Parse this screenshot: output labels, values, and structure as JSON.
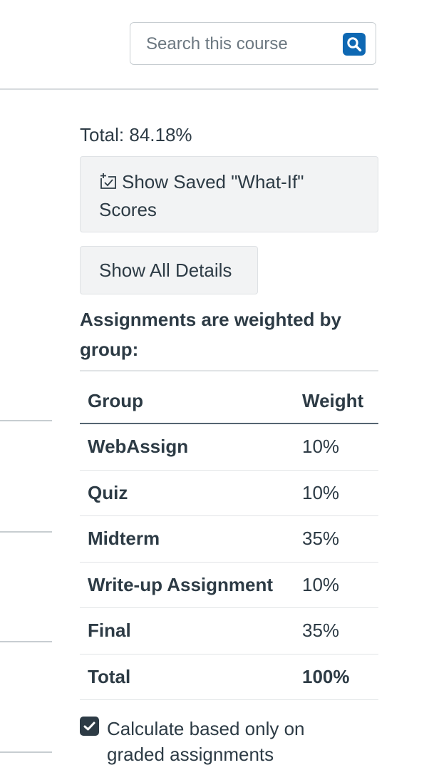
{
  "search": {
    "placeholder": "Search this course",
    "icon": "search-icon"
  },
  "grade": {
    "total_text": "Total: 84.18%"
  },
  "buttons": {
    "whatif_label": "Show Saved \"What-If\" Scores",
    "whatif_icon": "calendar-check-icon",
    "details_label": "Show All Details"
  },
  "weights": {
    "heading": "Assignments are weighted by group:",
    "columns": {
      "group": "Group",
      "weight": "Weight"
    },
    "rows": [
      {
        "group": "WebAssign",
        "weight": "10%"
      },
      {
        "group": "Quiz",
        "weight": "10%"
      },
      {
        "group": "Midterm",
        "weight": "35%"
      },
      {
        "group": "Write-up Assignment",
        "weight": "10%"
      },
      {
        "group": "Final",
        "weight": "35%"
      }
    ],
    "total": {
      "group": "Total",
      "weight": "100%"
    }
  },
  "calculate": {
    "label": "Calculate based only on graded assignments",
    "checked": true
  },
  "colors": {
    "accent": "#0e68b3",
    "text": "#2d3b45",
    "button_bg": "#f2f3f4"
  }
}
